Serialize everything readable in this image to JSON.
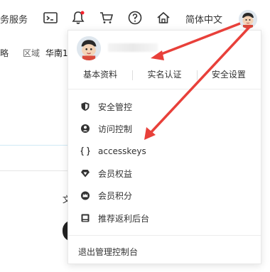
{
  "topbar": {
    "service_label": "务服务",
    "language_label": "简体中文"
  },
  "subrow": {
    "left_label": "略",
    "region_label": "区域",
    "region_value": "华南1"
  },
  "panel": {
    "username": "",
    "tabs": [
      "基本资料",
      "实名认证",
      "安全设置"
    ],
    "menu": [
      {
        "label": "安全管控",
        "icon": "shield-icon"
      },
      {
        "label": "访问控制",
        "icon": "user-circle-icon"
      },
      {
        "label": "accesskeys",
        "icon": "key-bracket-icon"
      },
      {
        "label": "会员权益",
        "icon": "diamond-icon"
      },
      {
        "label": "会员积分",
        "icon": "crown-icon"
      },
      {
        "label": "推荐返利后台",
        "icon": "badge-icon"
      }
    ],
    "logout_label": "退出管理控制台"
  },
  "background": {
    "fragment_text": "文"
  },
  "colors": {
    "arrow": "#e8403a",
    "notify_dot": "#f5222d"
  }
}
